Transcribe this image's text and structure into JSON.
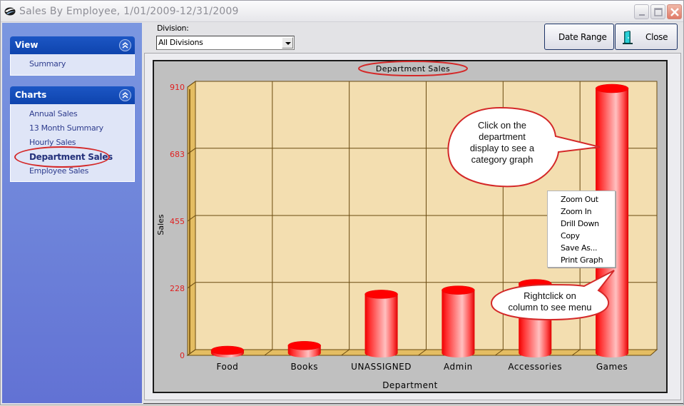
{
  "window": {
    "title": "Sales By Employee,  1/01/2009-12/31/2009",
    "icons": {
      "app": "app-logo-icon",
      "minimize": "minimize-icon",
      "maximize": "maximize-icon",
      "close": "close-icon"
    }
  },
  "sidebar": {
    "view_panel": {
      "title": "View",
      "items": [
        {
          "label": "Summary"
        }
      ]
    },
    "charts_panel": {
      "title": "Charts",
      "items": [
        {
          "label": "Annual Sales"
        },
        {
          "label": "13 Month Summary"
        },
        {
          "label": "Hourly Sales"
        },
        {
          "label": "Department Sales",
          "active": true
        },
        {
          "label": "Employee Sales"
        }
      ]
    }
  },
  "toolbar": {
    "division_label": "Division:",
    "division_value": "All Divisions",
    "date_range_label": "Date Range",
    "close_label": "Close"
  },
  "context_menu": {
    "items": [
      "Zoom Out",
      "Zoom In",
      "Drill Down",
      "Copy",
      "Save As...",
      "Print Graph"
    ]
  },
  "callouts": {
    "click": [
      "Click on the",
      "department",
      "display to see a",
      "category graph"
    ],
    "rightclick": [
      "Rightclick on",
      "column to see menu"
    ]
  },
  "colors": {
    "bar": "#ff0000",
    "plot_bg": "#f3deb0",
    "wall_side": "#e4bd62",
    "tick_label": "#e02020",
    "annotation_ring": "#d42828",
    "sidebar_header": "#1c56c4"
  },
  "chart_data": {
    "type": "bar",
    "style": "3d-cylinder",
    "title": "Department Sales",
    "xlabel": "Department",
    "ylabel": "Sales",
    "categories": [
      "Food",
      "Books",
      "UNASSIGNED",
      "Admin",
      "Accessories",
      "Games"
    ],
    "values": [
      15,
      38,
      212,
      226,
      248,
      910
    ],
    "yticks": [
      0,
      228,
      455,
      683,
      910
    ],
    "ylim": [
      0,
      910
    ],
    "grid": true,
    "legend": "none"
  }
}
